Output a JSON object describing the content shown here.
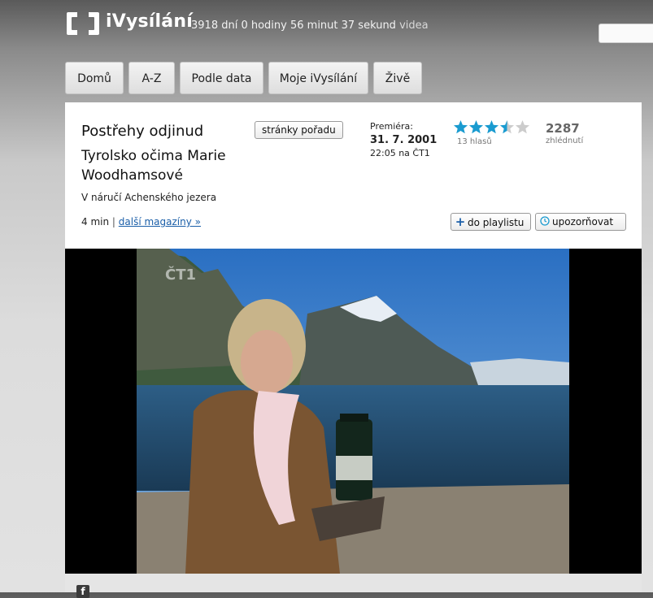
{
  "header": {
    "brand": "iVysílání",
    "counter": "3918 dní 0 hodiny 56 minut 37 sekund",
    "counter_suffix": "videa",
    "search_placeholder": ""
  },
  "nav": {
    "tabs": [
      "Domů",
      "A-Z",
      "Podle data",
      "Moje iVysílání",
      "Živě"
    ]
  },
  "program": {
    "title": "Postřehy odjinud",
    "subtitle": "Tyrolsko očima Marie Woodhamsové",
    "description": "V náručí Achenského jezera",
    "duration": "4 min",
    "separator": "|",
    "more_link": "další magazíny »",
    "show_page_button": "stránky pořadu"
  },
  "premiere": {
    "label": "Premiéra:",
    "date": "31. 7. 2001",
    "time": "22:05 na ČT1"
  },
  "rating": {
    "stars": 3.5,
    "max": 5,
    "votes": "13 hlasů",
    "color_filled": "#1a9bd0",
    "color_empty": "#cccccc"
  },
  "views": {
    "count": "2287",
    "label": "zhlédnutí"
  },
  "actions": {
    "playlist": {
      "icon": "plus-icon",
      "label": "do playlistu"
    },
    "notify": {
      "icon": "clock-icon",
      "label": "upozorňovat"
    }
  },
  "video": {
    "channel_logo_icon": "ct1-logo-icon"
  },
  "footer": {
    "icon": "facebook-icon",
    "text": ""
  },
  "colors": {
    "link": "#1a5ea8",
    "accent": "#1a9bd0"
  }
}
